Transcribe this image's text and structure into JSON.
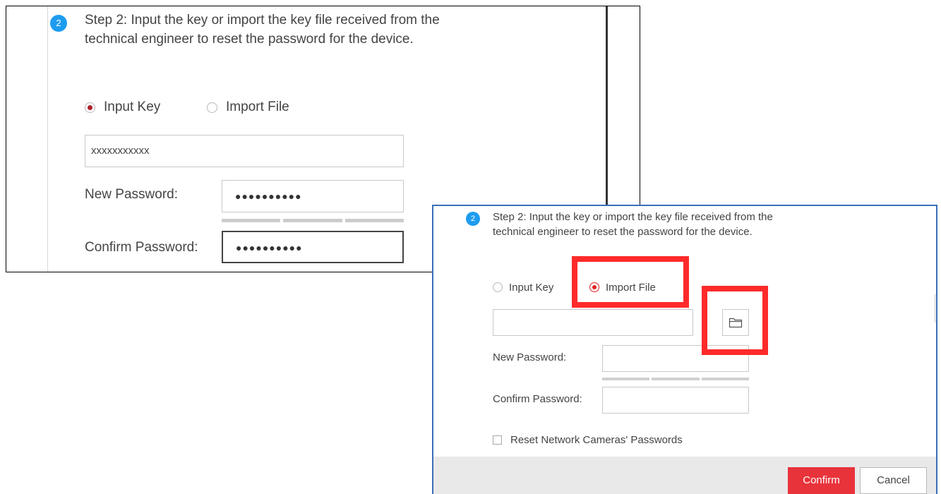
{
  "panel_zoom": {
    "step_number": "2",
    "step_text": "Step 2: Input the key or import the key file received from the technical engineer to reset the password for the device.",
    "options": [
      {
        "label": "Input Key",
        "selected": true
      },
      {
        "label": "Import File",
        "selected": false
      }
    ],
    "key_value": "xxxxxxxxxxx",
    "new_password_label": "New Password:",
    "new_password_value": "●●●●●●●●●●",
    "confirm_password_label": "Confirm Password:",
    "confirm_password_value": "●●●●●●●●●●"
  },
  "dialog": {
    "step_number": "2",
    "step_text": "Step 2: Input the key or import the key file received from the technical engineer to reset the password for the device.",
    "options": [
      {
        "label": "Input Key",
        "selected": false
      },
      {
        "label": "Import File",
        "selected": true
      }
    ],
    "file_path_value": "",
    "browse_icon": "folder-icon",
    "new_password_label": "New Password:",
    "new_password_value": "",
    "confirm_password_label": "Confirm Password:",
    "confirm_password_value": "",
    "reset_cameras_label": "Reset Network Cameras' Passwords",
    "reset_cameras_checked": false,
    "confirm_label": "Confirm",
    "cancel_label": "Cancel"
  },
  "colors": {
    "step_badge": "#1e9cf0",
    "highlight": "#ff2a2a",
    "confirm_button": "#e8333b",
    "dialog_border": "#3a6fb8"
  }
}
